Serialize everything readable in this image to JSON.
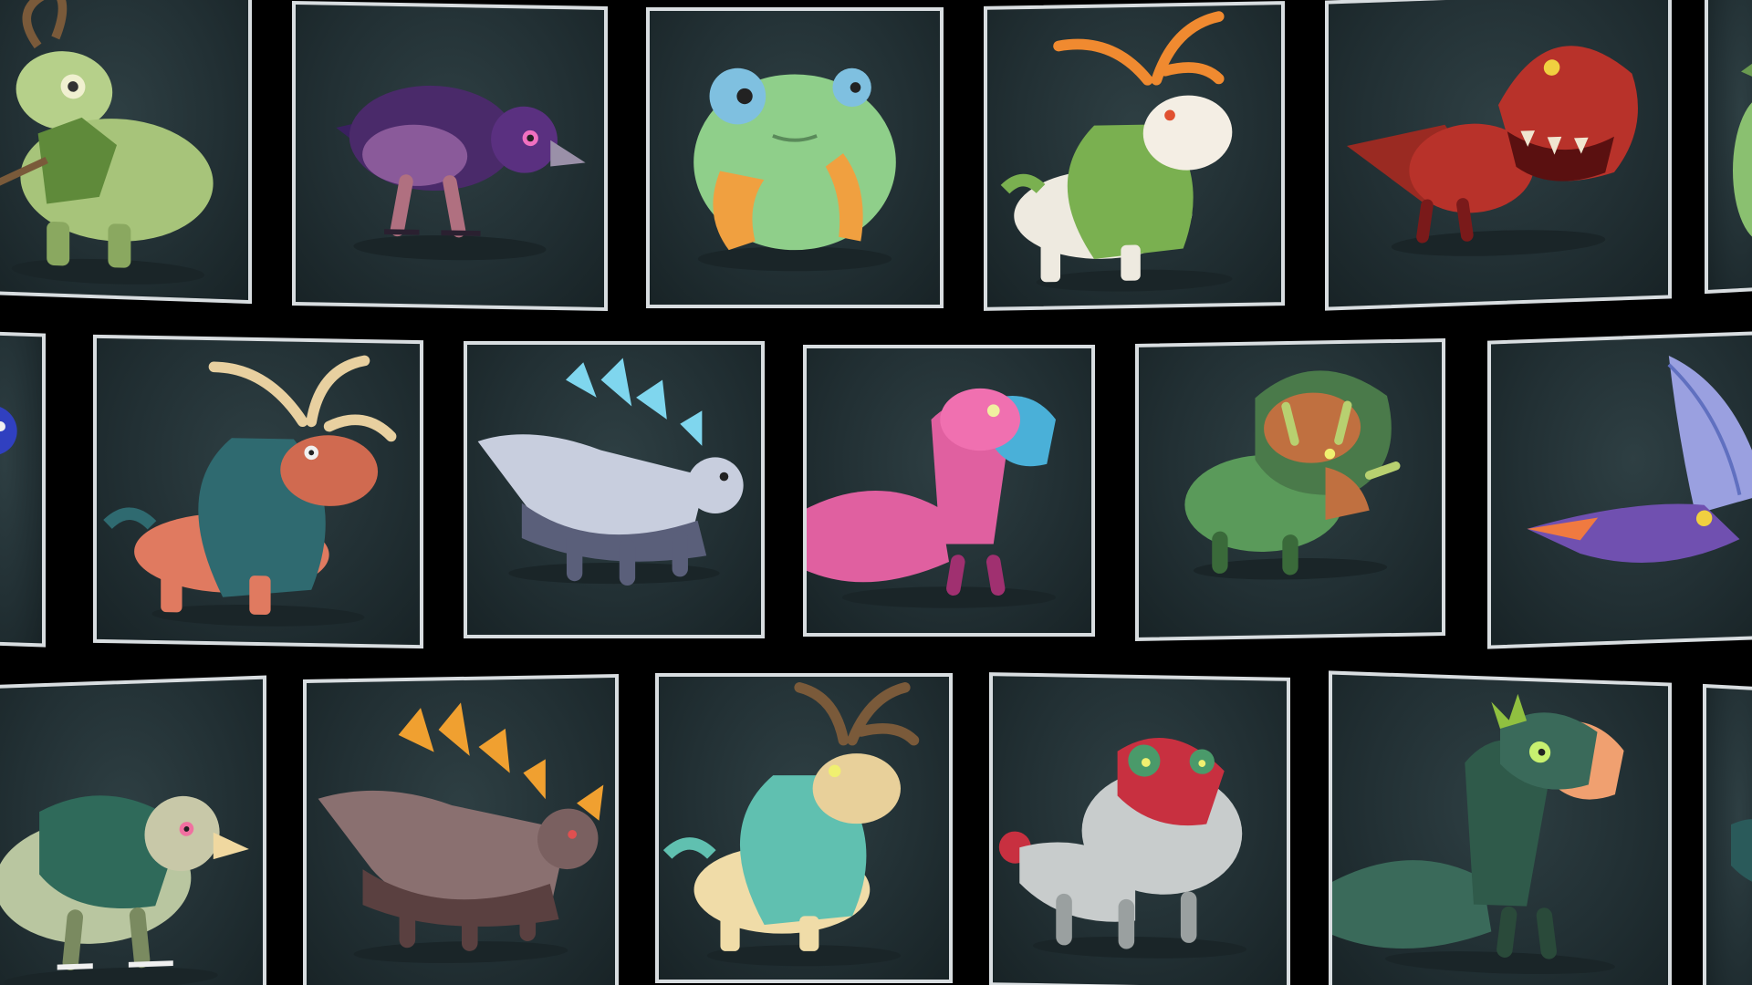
{
  "screen": {
    "background": "#000000"
  },
  "card_style": {
    "border_color": "#d8dde0",
    "panel_color": "#223034"
  },
  "rows": [
    {
      "cards": [
        {
          "creature": "leaf-deer",
          "colors": [
            "#a7c47a",
            "#5f8a3a",
            "#7a5a3a"
          ]
        },
        {
          "creature": "purple-crow",
          "colors": [
            "#4a2a6a",
            "#8a5a9a",
            "#c07a9a"
          ]
        },
        {
          "creature": "green-frog",
          "colors": [
            "#8fcf8a",
            "#f0a040",
            "#7fc0e0"
          ]
        },
        {
          "creature": "white-moss-elk",
          "colors": [
            "#eeeae0",
            "#7ab050",
            "#f08a30"
          ]
        },
        {
          "creature": "red-trex",
          "colors": [
            "#b8322a",
            "#7a1a1a",
            "#f0e6d0"
          ]
        },
        {
          "creature": "partial-green-creature",
          "colors": [
            "#8ac070"
          ]
        }
      ]
    },
    {
      "cards": [
        {
          "creature": "partial-blue-creature",
          "colors": [
            "#3040c0"
          ]
        },
        {
          "creature": "teal-maned-elk",
          "colors": [
            "#e07a60",
            "#2f6a70",
            "#e8d0a0"
          ]
        },
        {
          "creature": "crystal-stegosaurus",
          "colors": [
            "#c8cede",
            "#5a5f7a",
            "#7fd6ee"
          ]
        },
        {
          "creature": "pink-two-headed-raptor",
          "colors": [
            "#e060a0",
            "#a03070",
            "#4ab0d8"
          ]
        },
        {
          "creature": "green-triceratops",
          "colors": [
            "#5a9a5a",
            "#c07040",
            "#b8d070"
          ]
        },
        {
          "creature": "purple-pterodactyl",
          "colors": [
            "#7050b0",
            "#f07a40",
            "#9aa0e0"
          ]
        }
      ]
    },
    {
      "cards": [
        {
          "creature": "green-griffin",
          "colors": [
            "#2f6a5a",
            "#b9c6a0",
            "#f0d8a0"
          ]
        },
        {
          "creature": "amber-crystal-stegosaurus",
          "colors": [
            "#8a7070",
            "#5a4040",
            "#f0a030"
          ]
        },
        {
          "creature": "cyan-maned-elk",
          "colors": [
            "#f0dca8",
            "#60c0b0",
            "#7a5a3a"
          ]
        },
        {
          "creature": "red-grey-dino",
          "colors": [
            "#c8cccc",
            "#c83040",
            "#4a9a6a"
          ]
        },
        {
          "creature": "green-two-headed-raptor",
          "colors": [
            "#3a6a5a",
            "#90c040",
            "#f0a070"
          ]
        },
        {
          "creature": "partial-teal-creature",
          "colors": [
            "#2a5a5a"
          ]
        }
      ]
    }
  ]
}
